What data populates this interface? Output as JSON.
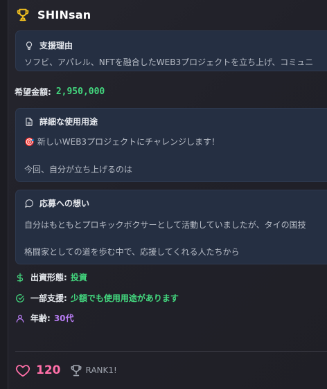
{
  "title": "SHINsan",
  "reason": {
    "title": "支援理由",
    "text": "ソフビ、アパレル、NFTを融合したWEB3プロジェクトを立ち上げ、コミュニ"
  },
  "amount": {
    "label": "希望金額:",
    "value": "2,950,000"
  },
  "usage": {
    "title": "詳細な使用用途",
    "line1": "🎯 新しいWEB3プロジェクトにチャレンジします！",
    "line2": "今回、自分が立ち上げるのは"
  },
  "thoughts": {
    "title": "応募への想い",
    "line1": "自分はもともとプロキックボクサーとして活動していましたが、タイの国技",
    "line2": "格闘家としての道を歩む中で、応援してくれる人たちから"
  },
  "investment": {
    "label": "出資形態:",
    "value": "投資"
  },
  "partial": {
    "label": "一部支援:",
    "value": "少額でも使用用途があります"
  },
  "age": {
    "label": "年齢:",
    "value": "30代"
  },
  "footer": {
    "likes": "120",
    "rank": "RANK1!"
  },
  "colors": {
    "trophy": "#f4c21f",
    "amount": "#43d77e",
    "investment": "#43d77e",
    "partial": "#43d77e",
    "age": "#b77cf2",
    "heart": "#ff6fa8"
  },
  "icons": {
    "title": "trophy-icon",
    "reason": "lightbulb-icon",
    "usage": "document-icon",
    "thoughts": "message-circle-icon",
    "investment": "dollar-icon",
    "partial": "check-circle-icon",
    "age": "user-icon",
    "likes": "heart-icon",
    "rank": "trophy-outline-icon"
  }
}
